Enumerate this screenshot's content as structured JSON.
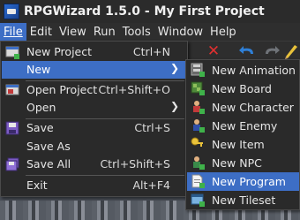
{
  "app": {
    "title": "RPGWizard 1.5.0 - My First Project"
  },
  "menubar": {
    "items": [
      {
        "label": "File",
        "mnemonic_index": 0
      },
      {
        "label": "Edit"
      },
      {
        "label": "View"
      },
      {
        "label": "Run"
      },
      {
        "label": "Tools"
      },
      {
        "label": "Window"
      },
      {
        "label": "Help"
      }
    ]
  },
  "file_menu": {
    "items": [
      {
        "label": "New Project",
        "shortcut": "Ctrl+N",
        "icon": "new-project-icon"
      },
      {
        "label": "New",
        "submenu": true,
        "highlighted": true
      },
      {
        "label": "Open Project",
        "shortcut": "Ctrl+Shift+O",
        "icon": "open-project-icon"
      },
      {
        "label": "Open",
        "submenu": true
      },
      {
        "label": "Save",
        "shortcut": "Ctrl+S",
        "icon": "save-icon"
      },
      {
        "label": "Save As",
        "icon": "save-as-icon"
      },
      {
        "label": "Save All",
        "shortcut": "Ctrl+Shift+S",
        "icon": "save-all-icon"
      },
      {
        "label": "Exit",
        "shortcut": "Alt+F4"
      }
    ]
  },
  "new_submenu": {
    "items": [
      {
        "label": "New Animation",
        "icon": "animation-icon"
      },
      {
        "label": "New Board",
        "icon": "board-icon"
      },
      {
        "label": "New Character",
        "icon": "character-icon"
      },
      {
        "label": "New Enemy",
        "icon": "enemy-icon"
      },
      {
        "label": "New Item",
        "icon": "item-key-icon"
      },
      {
        "label": "New NPC",
        "icon": "npc-icon"
      },
      {
        "label": "New Program",
        "icon": "program-icon",
        "highlighted": true
      },
      {
        "label": "New Tileset",
        "icon": "tileset-icon"
      }
    ]
  },
  "colors": {
    "highlight": "#3d6ec5",
    "menu_bg": "#2a2a2a",
    "titlebar_bg": "#2b2b2b"
  }
}
